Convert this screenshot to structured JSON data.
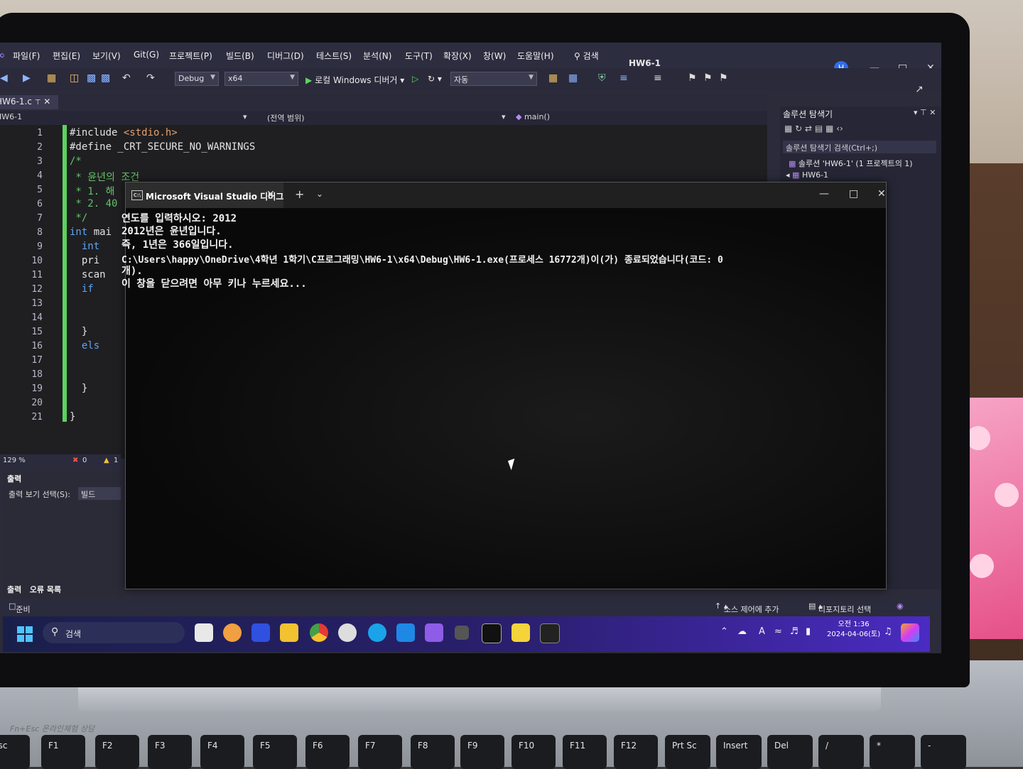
{
  "menu": [
    "파일(F)",
    "편집(E)",
    "보기(V)",
    "Git(G)",
    "프로젝트(P)",
    "빌드(B)",
    "디버그(D)",
    "테스트(S)",
    "분석(N)",
    "도구(T)",
    "확장(X)",
    "창(W)",
    "도움말(H)"
  ],
  "search_label": "검색",
  "project_title": "HW6-1",
  "user_initial": "H",
  "toolbar": {
    "config": "Debug",
    "platform": "x64",
    "run_label": "로컬 Windows 디버거",
    "startup": "자동"
  },
  "doc_tab": "HW6-1.c",
  "nav": {
    "project": "HW6-1",
    "scope": "(전역 범위)",
    "function": "main()"
  },
  "line_numbers": [
    "1",
    "2",
    "3",
    "4",
    "5",
    "6",
    "7",
    "8",
    "9",
    "10",
    "11",
    "12",
    "13",
    "14",
    "15",
    "16",
    "17",
    "18",
    "19",
    "20",
    "21"
  ],
  "code": {
    "l1_a": "#include ",
    "l1_b": "<stdio.h>",
    "l2": "#define _CRT_SECURE_NO_WARNINGS",
    "l3": "/*",
    "l4": " * 윤년의 조건",
    "l5": " * 1. 해",
    "l6": " * 2. 40",
    "l7": " */",
    "l8_kw": "int",
    "l8_rest": " mai",
    "l9": "  int",
    "l10": "  pri",
    "l11": "  scan",
    "l12": "  if",
    "l15": "  }",
    "l16": "  els",
    "l19": "  }",
    "l21": "}"
  },
  "editor_status": {
    "zoom": "129 %",
    "errors": "0",
    "warnings": "1"
  },
  "output": {
    "title": "출력",
    "select_label": "출력 보기 선택(S):",
    "source": "빌드",
    "tabs": [
      "출력",
      "오류 목록"
    ]
  },
  "solution": {
    "title": "솔루션 탐색기",
    "search": "솔루션 탐색기 검색(Ctrl+;)",
    "root": "솔루션 'HW6-1' (1 프로젝트의 1)",
    "project": "HW6-1"
  },
  "status_bar": {
    "ready": "준비",
    "source_control": "소스 제어에 추가",
    "repo": "리포지토리 선택"
  },
  "terminal": {
    "tab_title": "Microsoft Visual Studio 디버그",
    "lines": [
      "연도를 입력하시오: 2012",
      "2012년은 윤년입니다.",
      "즉, 1년은 366일입니다.",
      "C:\\Users\\happy\\OneDrive\\4학년 1학기\\C프로그래밍\\HW6-1\\x64\\Debug\\HW6-1.exe(프로세스 16772개)이(가) 종료되었습니다(코드: 0",
      "개).",
      "이 창을 닫으려면 아무 키나 누르세요..."
    ]
  },
  "taskbar": {
    "search": "검색",
    "time": "오전 1:36",
    "date": "2024-04-06(토)"
  },
  "keyboard": {
    "fn_label": "Fn+Esc 온라인체험 상담",
    "keys": [
      "Esc",
      "F1",
      "F2",
      "F3",
      "F4",
      "F5",
      "F6",
      "F7",
      "F8",
      "F9",
      "F10",
      "F11",
      "F12",
      "Prt Sc",
      "Insert",
      "Del"
    ]
  },
  "colors": {
    "vs_accent": "#9a7ef5",
    "changed_line_bar": "#5dd15d",
    "terminal_bg": "#0c0c0c",
    "taskbar_end": "#4b2bc2"
  }
}
